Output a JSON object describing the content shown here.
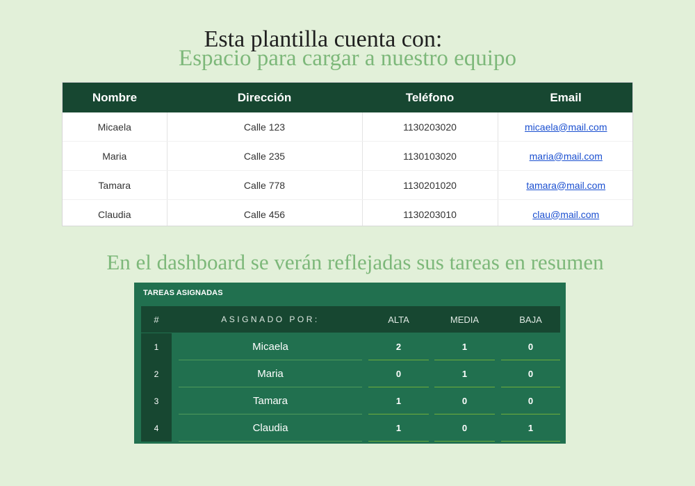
{
  "headings": {
    "main": "Esta plantilla cuenta con:",
    "team": "Espacio para cargar a nuestro equipo",
    "dashboard": "En el dashboard se verán reflejadas sus tareas en resumen"
  },
  "contacts": {
    "columns": [
      "Nombre",
      "Dirección",
      "Teléfono",
      "Email"
    ],
    "rows": [
      {
        "name": "Micaela",
        "address": "Calle 123",
        "phone": "1130203020",
        "email": "micaela@mail.com"
      },
      {
        "name": "Maria",
        "address": "Calle 235",
        "phone": "1130103020",
        "email": "maria@mail.com"
      },
      {
        "name": "Tamara",
        "address": "Calle 778",
        "phone": "1130201020",
        "email": "tamara@mail.com"
      },
      {
        "name": "Claudia",
        "address": "Calle 456",
        "phone": "1130203010",
        "email": "clau@mail.com"
      }
    ]
  },
  "tasks": {
    "title": "TAREAS ASIGNADAS",
    "columns": [
      "#",
      "ASIGNADO POR:",
      "ALTA",
      "MEDIA",
      "BAJA"
    ],
    "rows": [
      {
        "num": "1",
        "name": "Micaela",
        "alta": "2",
        "media": "1",
        "baja": "0"
      },
      {
        "num": "2",
        "name": "Maria",
        "alta": "0",
        "media": "1",
        "baja": "0"
      },
      {
        "num": "3",
        "name": "Tamara",
        "alta": "1",
        "media": "0",
        "baja": "0"
      },
      {
        "num": "4",
        "name": "Claudia",
        "alta": "1",
        "media": "0",
        "baja": "1"
      }
    ]
  },
  "colors": {
    "background": "#e2f0d9",
    "header_dark_green": "#174731",
    "panel_green": "#21704f",
    "accent_green_text": "#7db87a",
    "link_blue": "#1a4fd0"
  }
}
